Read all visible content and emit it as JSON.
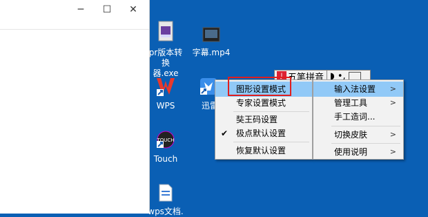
{
  "window": {
    "minimize_icon": "─",
    "maximize_icon": "☐",
    "close_icon": "✕"
  },
  "desktop": {
    "icons": [
      {
        "label": "pr版本转换器.exe",
        "label_line1": "pr版本转换",
        "label_line2": "器.exe"
      },
      {
        "label": "字幕.mp4"
      },
      {
        "label": "WPS"
      },
      {
        "label": "迅雷"
      },
      {
        "label": "Touch"
      },
      {
        "label": "wps文档",
        "partial": "wps文档."
      }
    ]
  },
  "ime_toolbar": {
    "text": "五笔拼音"
  },
  "main_menu": {
    "items": [
      {
        "label": "图形设置模式",
        "highlighted": true
      },
      {
        "label": "专家设置模式"
      },
      {
        "label": "奘王码设置"
      },
      {
        "label": "极点默认设置",
        "checked": true
      },
      {
        "label": "恢复默认设置"
      }
    ]
  },
  "sub_menu": {
    "items": [
      {
        "label": "输入法设置",
        "arrow": ">",
        "highlighted": true
      },
      {
        "label": "管理工具",
        "arrow": ">"
      },
      {
        "label": "手工造词..."
      },
      {
        "label": "切换皮肤",
        "arrow": ">"
      },
      {
        "label": "使用说明",
        "arrow": ">"
      }
    ]
  },
  "colors": {
    "desktop": "#0a5fb4",
    "highlight": "#91c9f7",
    "red_frame": "#e01e1e"
  }
}
